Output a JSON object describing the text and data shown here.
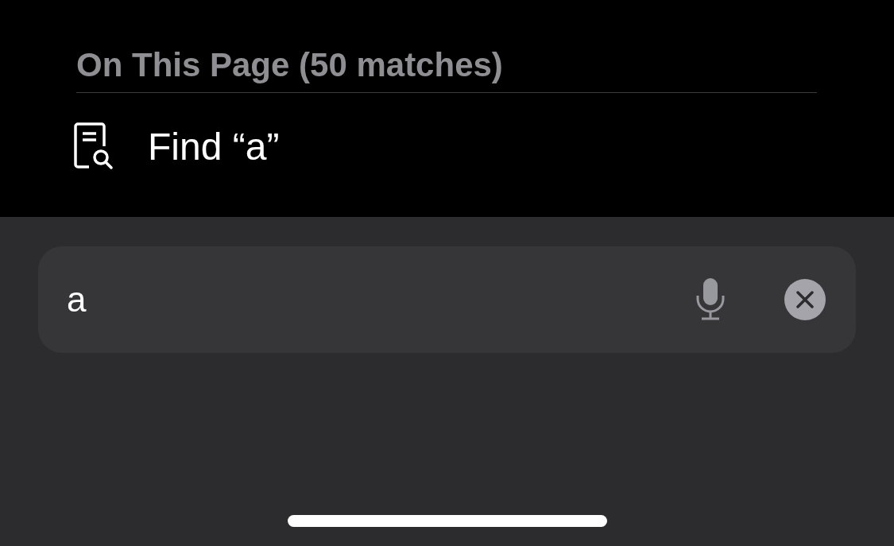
{
  "section": {
    "title": "On This Page (50 matches)"
  },
  "results": [
    {
      "label": "Find “a”"
    }
  ],
  "search": {
    "value": "a"
  }
}
